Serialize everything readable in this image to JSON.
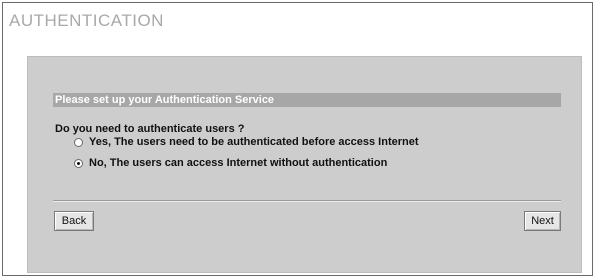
{
  "page": {
    "title": "AUTHENTICATION"
  },
  "section": {
    "header": "Please set up your Authentication Service"
  },
  "form": {
    "question": "Do you need to authenticate users ?",
    "options": [
      {
        "label": "Yes, The users need to be authenticated before access Internet",
        "selected": false
      },
      {
        "label": "No, The users can access Internet without authentication",
        "selected": true
      }
    ]
  },
  "buttons": {
    "back": "Back",
    "next": "Next"
  },
  "colors": {
    "panel": "#cdcdcd",
    "section_header": "#a7a7a7",
    "title": "#a9a9a9"
  }
}
